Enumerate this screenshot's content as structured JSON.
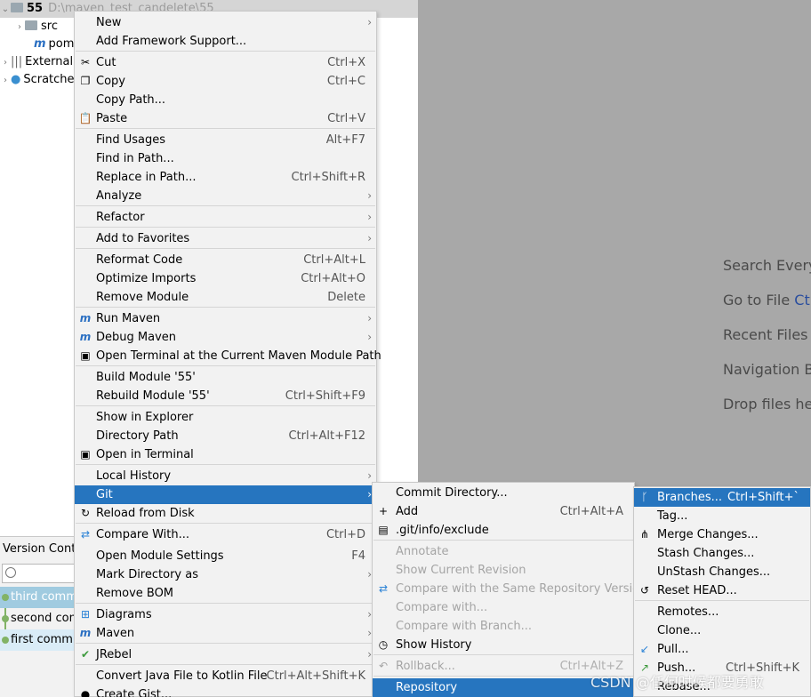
{
  "project_tree": {
    "root": {
      "name": "55",
      "path": "D:\\maven_test_candelete\\55"
    },
    "items": [
      {
        "label": "src",
        "icon": "folder-icon"
      },
      {
        "label": "pom",
        "icon": "maven-icon"
      },
      {
        "label": "External",
        "icon": "library-icon"
      },
      {
        "label": "Scratche",
        "icon": "scratches-icon"
      }
    ]
  },
  "editor_hints": {
    "search": {
      "text": "Search Everyw",
      "key": ""
    },
    "goto_file": {
      "text": "Go to File ",
      "key": "Ctr"
    },
    "recent": {
      "text": "Recent Files ",
      "key": "C"
    },
    "navigation": {
      "text": "Navigation B",
      "key": ""
    },
    "drop": {
      "text": "Drop files her",
      "key": ""
    }
  },
  "vcs_panel": {
    "title": "Version Contr",
    "search_placeholder": "",
    "commits": [
      "third commi",
      "second com",
      "first commit"
    ]
  },
  "context_menu": {
    "items": [
      {
        "label": "New",
        "shortcut": "",
        "submenu": true
      },
      {
        "label": "Add Framework Support...",
        "shortcut": ""
      },
      {
        "label": "Cut",
        "shortcut": "Ctrl+X",
        "icon": "scissors-icon"
      },
      {
        "label": "Copy",
        "shortcut": "Ctrl+C",
        "icon": "copy-icon"
      },
      {
        "label": "Copy Path...",
        "shortcut": ""
      },
      {
        "label": "Paste",
        "shortcut": "Ctrl+V",
        "icon": "paste-icon"
      },
      {
        "label": "Find Usages",
        "shortcut": "Alt+F7"
      },
      {
        "label": "Find in Path...",
        "shortcut": ""
      },
      {
        "label": "Replace in Path...",
        "shortcut": "Ctrl+Shift+R"
      },
      {
        "label": "Analyze",
        "shortcut": "",
        "submenu": true
      },
      {
        "label": "Refactor",
        "shortcut": "",
        "submenu": true
      },
      {
        "label": "Add to Favorites",
        "shortcut": "",
        "submenu": true
      },
      {
        "label": "Reformat Code",
        "shortcut": "Ctrl+Alt+L"
      },
      {
        "label": "Optimize Imports",
        "shortcut": "Ctrl+Alt+O"
      },
      {
        "label": "Remove Module",
        "shortcut": "Delete"
      },
      {
        "label": "Run Maven",
        "shortcut": "",
        "submenu": true,
        "icon": "run-maven-icon"
      },
      {
        "label": "Debug Maven",
        "shortcut": "",
        "submenu": true,
        "icon": "debug-maven-icon"
      },
      {
        "label": "Open Terminal at the Current Maven Module Path",
        "shortcut": "",
        "icon": "terminal-maven-icon"
      },
      {
        "label": "Build Module '55'",
        "shortcut": ""
      },
      {
        "label": "Rebuild Module '55'",
        "shortcut": "Ctrl+Shift+F9"
      },
      {
        "label": "Show in Explorer",
        "shortcut": ""
      },
      {
        "label": "Directory Path",
        "shortcut": "Ctrl+Alt+F12"
      },
      {
        "label": "Open in Terminal",
        "shortcut": "",
        "icon": "terminal-icon"
      },
      {
        "label": "Local History",
        "shortcut": "",
        "submenu": true
      },
      {
        "label": "Git",
        "shortcut": "",
        "submenu": true,
        "selected": true
      },
      {
        "label": "Reload from Disk",
        "shortcut": "",
        "icon": "reload-icon"
      },
      {
        "label": "Compare With...",
        "shortcut": "Ctrl+D",
        "icon": "compare-icon"
      },
      {
        "label": "Open Module Settings",
        "shortcut": "F4"
      },
      {
        "label": "Mark Directory as",
        "shortcut": "",
        "submenu": true
      },
      {
        "label": "Remove BOM",
        "shortcut": ""
      },
      {
        "label": "Diagrams",
        "shortcut": "",
        "submenu": true,
        "icon": "diagrams-icon"
      },
      {
        "label": "Maven",
        "shortcut": "",
        "submenu": true,
        "icon": "maven-icon"
      },
      {
        "label": "JRebel",
        "shortcut": "",
        "submenu": true,
        "icon": "jrebel-icon"
      },
      {
        "label": "Convert Java File to Kotlin File",
        "shortcut": "Ctrl+Alt+Shift+K"
      },
      {
        "label": "Create Gist...",
        "shortcut": "",
        "icon": "github-icon"
      }
    ]
  },
  "git_menu": {
    "items": [
      {
        "label": "Commit Directory...",
        "shortcut": ""
      },
      {
        "label": "Add",
        "shortcut": "Ctrl+Alt+A",
        "icon": "plus-icon"
      },
      {
        "label": ".git/info/exclude",
        "shortcut": "",
        "icon": "file-icon"
      },
      {
        "label": "Annotate",
        "shortcut": "",
        "disabled": true
      },
      {
        "label": "Show Current Revision",
        "shortcut": "",
        "disabled": true
      },
      {
        "label": "Compare with the Same Repository Version",
        "shortcut": "",
        "disabled": true,
        "icon": "compare-icon"
      },
      {
        "label": "Compare with...",
        "shortcut": "",
        "disabled": true
      },
      {
        "label": "Compare with Branch...",
        "shortcut": "",
        "disabled": true
      },
      {
        "label": "Show History",
        "shortcut": "",
        "icon": "clock-icon"
      },
      {
        "label": "Rollback...",
        "shortcut": "Ctrl+Alt+Z",
        "disabled": true,
        "icon": "rollback-icon"
      },
      {
        "label": "Repository",
        "shortcut": "",
        "selected": true
      }
    ]
  },
  "repo_menu": {
    "items": [
      {
        "label": "Branches...",
        "shortcut": "Ctrl+Shift+`",
        "selected": true,
        "icon": "branch-icon"
      },
      {
        "label": "Tag...",
        "shortcut": ""
      },
      {
        "label": "Merge Changes...",
        "shortcut": "",
        "icon": "merge-icon"
      },
      {
        "label": "Stash Changes...",
        "shortcut": ""
      },
      {
        "label": "UnStash Changes...",
        "shortcut": ""
      },
      {
        "label": "Reset HEAD...",
        "shortcut": "",
        "icon": "reset-icon"
      },
      {
        "label": "Remotes...",
        "shortcut": ""
      },
      {
        "label": "Clone...",
        "shortcut": ""
      },
      {
        "label": "Pull...",
        "shortcut": "",
        "icon": "pull-icon"
      },
      {
        "label": "Push...",
        "shortcut": "Ctrl+Shift+K",
        "icon": "push-icon"
      },
      {
        "label": "Rebase...",
        "shortcut": ""
      }
    ]
  },
  "watermark": "CSDN @任何时候都要勇敢"
}
